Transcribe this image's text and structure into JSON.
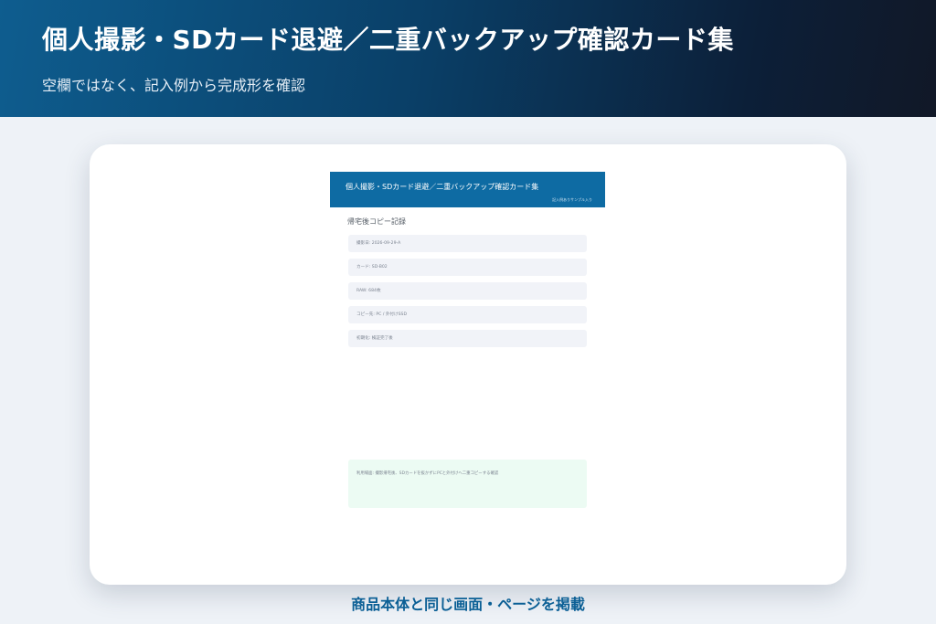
{
  "hero": {
    "title": "個人撮影・SDカード退避／二重バックアップ確認カード集",
    "subtitle": "空欄ではなく、記入例から完成形を確認"
  },
  "mock": {
    "header_title": "個人撮影・SDカード退避／二重バックアップ確認カード集",
    "header_tag": "記入例ありサンプル入り",
    "section_title": "帰宅後コピー記録",
    "fields": [
      {
        "label": "撮影日: 2026-09-29-A"
      },
      {
        "label": "カード: SD-B02"
      },
      {
        "label": "RAW: 684枚"
      },
      {
        "label": "コピー先: PC / 外付けSSD"
      },
      {
        "label": "初期化: 検証完了後"
      }
    ],
    "note": "利用場面: 撮影帰宅後、SDカードを抜かずにPCと外付けへ二重コピーする確認"
  },
  "caption": "商品本体と同じ画面・ページを掲載",
  "colors": {
    "hero_start": "#0e5d8f",
    "hero_end": "#111827",
    "mock_header": "#0e6ba3",
    "field_bg": "#f1f3f8",
    "note_bg": "#ecfbf3",
    "caption": "#0b5f95",
    "page_bg": "#eef2f7"
  }
}
